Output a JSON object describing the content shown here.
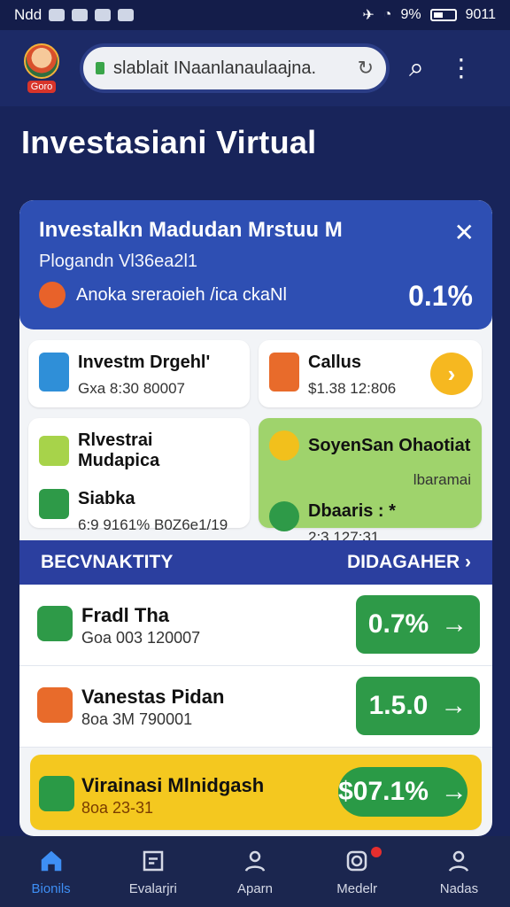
{
  "status_bar": {
    "carrier": "Ndd",
    "battery": "9%",
    "time": "9011"
  },
  "browser": {
    "logo_text": "Goro",
    "url": "slablait INaanlanaulaajna.",
    "icons": [
      "lock-icon",
      "reload-icon",
      "search-icon",
      "more-vertical-icon"
    ]
  },
  "page": {
    "title": "Investasiani Virtual"
  },
  "banner": {
    "title": "Investalkn Madudan Mrstuu M",
    "subtitle": "Plogandn Vl36ea2l1",
    "note": "Anoka sreraoieh /ica ckaNl",
    "percent": "0.1%"
  },
  "tiles": [
    {
      "title": "Investm Drgehl'",
      "subtitle": "Gxa 8:30 80007"
    },
    {
      "title": "Callus",
      "subtitle": "$1.38 12:806"
    },
    {
      "title": "Rlvestrai Mudapica",
      "subtitle": "Siabka",
      "meta": "6:9 9161% B0Z6e1/19"
    },
    {
      "title": "SoyenSan Ohaotiat",
      "subtitle": "lbaramai",
      "meta_title": "Dbaaris : *",
      "meta": "2:3 127:31"
    }
  ],
  "section": {
    "left": "BECVNAKTITY",
    "right": "DIDAGAHER"
  },
  "list": [
    {
      "title": "Fradl Tha",
      "subtitle": "Goa 003 120007",
      "value": "0.7%"
    },
    {
      "title": "Vanestas Pidan",
      "subtitle": "8oa 3M 790001",
      "value": "1.5.0"
    },
    {
      "title": "Virainasi Mlnidgash",
      "subtitle": "8oa 23-31",
      "value": "$07.1%"
    }
  ],
  "nav": [
    {
      "label": "Bionils",
      "icon": "home-icon",
      "active": true
    },
    {
      "label": "Evalarjri",
      "icon": "document-icon",
      "active": false
    },
    {
      "label": "Aparn",
      "icon": "user-icon",
      "active": false
    },
    {
      "label": "Medelr",
      "icon": "instagram-icon",
      "active": false
    },
    {
      "label": "Nadas",
      "icon": "person-icon",
      "active": false
    }
  ],
  "colors": {
    "primary": "#2e4fb3",
    "accent_green": "#2e9a48",
    "accent_yellow": "#f4c81f",
    "background": "#18245a"
  }
}
